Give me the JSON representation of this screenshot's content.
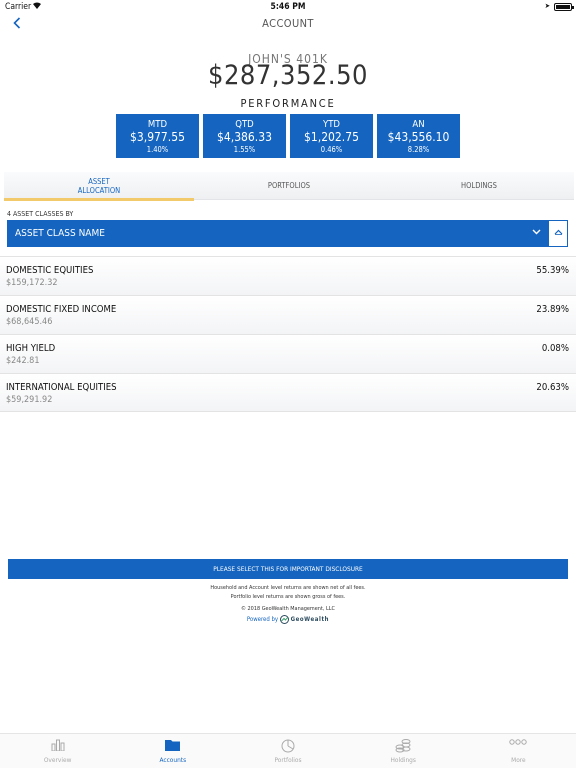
{
  "status_bar": {
    "carrier": "Carrier",
    "time": "5:46 PM"
  },
  "nav": {
    "title": "ACCOUNT"
  },
  "account": {
    "name": "JOHN'S 401K",
    "value": "$287,352.50"
  },
  "performance": {
    "title": "PERFORMANCE",
    "cards": [
      {
        "label": "MTD",
        "amount": "$3,977.55",
        "percent": "1.40%"
      },
      {
        "label": "QTD",
        "amount": "$4,386.33",
        "percent": "1.55%"
      },
      {
        "label": "YTD",
        "amount": "$1,202.75",
        "percent": "0.46%"
      },
      {
        "label": "AN",
        "amount": "$43,556.10",
        "percent": "8.28%"
      }
    ]
  },
  "tabs": [
    {
      "line1": "ASSET",
      "line2": "ALLOCATION",
      "active": true
    },
    {
      "line1": "PORTFOLIOS",
      "line2": "",
      "active": false
    },
    {
      "line1": "HOLDINGS",
      "line2": "",
      "active": false
    }
  ],
  "allocation": {
    "count_label": "4 ASSET CLASSES BY",
    "selected": "ASSET CLASS NAME",
    "rows": [
      {
        "name": "DOMESTIC EQUITIES",
        "amount": "$159,172.32",
        "percent": "55.39%"
      },
      {
        "name": "DOMESTIC FIXED INCOME",
        "amount": "$68,645.46",
        "percent": "23.89%"
      },
      {
        "name": "HIGH YIELD",
        "amount": "$242.81",
        "percent": "0.08%"
      },
      {
        "name": "INTERNATIONAL EQUITIES",
        "amount": "$59,291.92",
        "percent": "20.63%"
      }
    ]
  },
  "footer": {
    "disclosure_label": "PLEASE SELECT THIS FOR IMPORTANT DISCLOSURE",
    "note1": "Household and Account level returns are shown net of all fees.",
    "note2": "Portfolio level returns are shown gross of fees.",
    "copyright": "© 2018 GeoWealth Management, LLC",
    "powered_by": "Powered by",
    "brand": "GeoWealth"
  },
  "tab_bar": [
    {
      "label": "Overview",
      "icon": "bar-chart-icon",
      "active": false
    },
    {
      "label": "Accounts",
      "icon": "folder-icon",
      "active": true
    },
    {
      "label": "Portfolios",
      "icon": "pie-chart-icon",
      "active": false
    },
    {
      "label": "Holdings",
      "icon": "coins-icon",
      "active": false
    },
    {
      "label": "More",
      "icon": "more-dots-icon",
      "active": false
    }
  ],
  "colors": {
    "accent": "#1565c0",
    "tab_indicator": "#f2c96b"
  }
}
